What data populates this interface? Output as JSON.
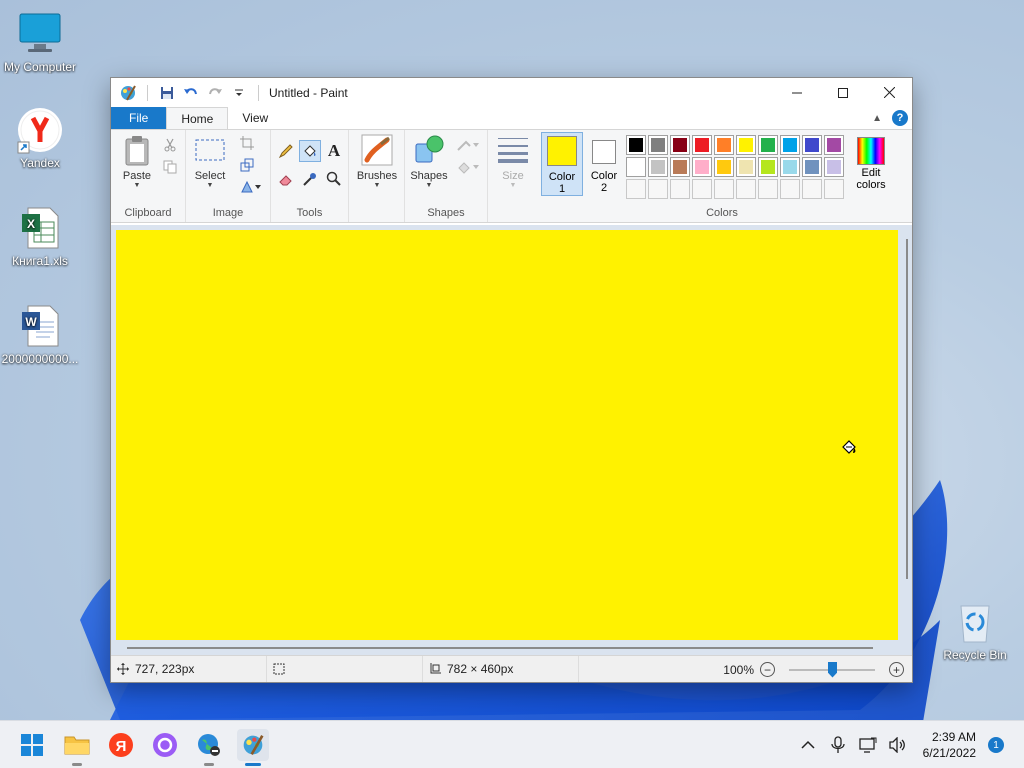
{
  "desktop": {
    "icons": [
      {
        "label": "My Computer"
      },
      {
        "label": "Yandex"
      },
      {
        "label": "Книга1.xls"
      },
      {
        "label": "2000000000..."
      },
      {
        "label": "Recycle Bin"
      }
    ]
  },
  "window": {
    "title": "Untitled - Paint",
    "tabs": {
      "file": "File",
      "home": "Home",
      "view": "View"
    },
    "ribbon": {
      "clipboard": {
        "paste": "Paste",
        "group": "Clipboard"
      },
      "image": {
        "select": "Select",
        "group": "Image"
      },
      "tools": {
        "group": "Tools"
      },
      "brushes": {
        "label": "Brushes"
      },
      "shapes": {
        "label": "Shapes",
        "group": "Shapes"
      },
      "size": {
        "label": "Size"
      },
      "colors": {
        "color1_line1": "Color",
        "color1_line2": "1",
        "color2_line1": "Color",
        "color2_line2": "2",
        "edit_line1": "Edit",
        "edit_line2": "colors",
        "group": "Colors",
        "color1_value": "#fff200",
        "color2_value": "#ffffff",
        "palette": [
          "#000000",
          "#7f7f7f",
          "#880015",
          "#ed1c24",
          "#ff7f27",
          "#fff200",
          "#22b14c",
          "#00a2e8",
          "#3f48cc",
          "#a349a4",
          "#ffffff",
          "#c3c3c3",
          "#b97a57",
          "#ffaec9",
          "#ffc90e",
          "#efe4b0",
          "#b5e61d",
          "#99d9ea",
          "#7092be",
          "#c8bfe7",
          "#ffffff",
          "#ffffff",
          "#ffffff",
          "#ffffff",
          "#ffffff",
          "#ffffff",
          "#ffffff",
          "#ffffff",
          "#ffffff",
          "#ffffff"
        ]
      }
    },
    "canvas_color": "#fff200",
    "status": {
      "cursor_pos": "727, 223px",
      "selection_size": "",
      "canvas_size": "782 × 460px",
      "zoom": "100%"
    }
  },
  "taskbar": {
    "time": "2:39 AM",
    "date": "6/21/2022",
    "notifications": "1"
  }
}
